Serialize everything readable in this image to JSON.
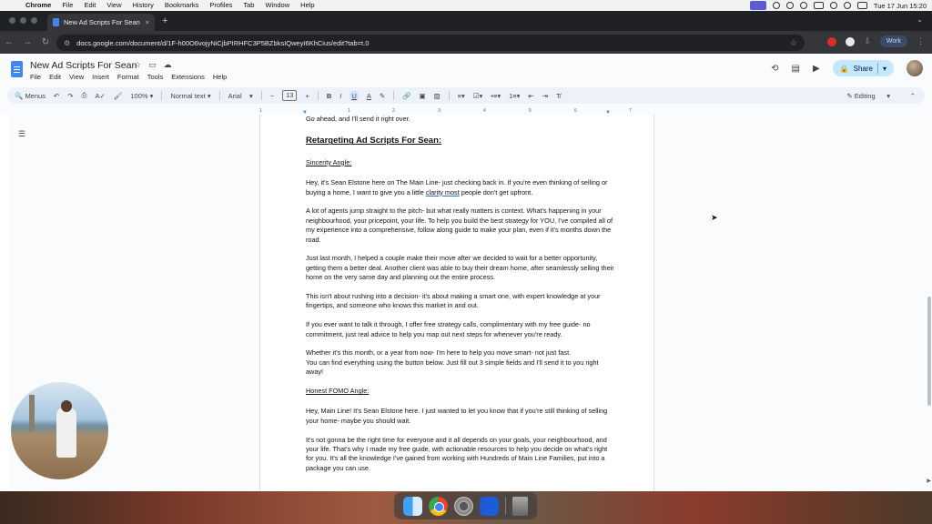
{
  "mac_menu": {
    "app": "Chrome",
    "items": [
      "File",
      "Edit",
      "View",
      "History",
      "Bookmarks",
      "Profiles",
      "Tab",
      "Window",
      "Help"
    ],
    "clock": "Tue 17 Jun  15:20"
  },
  "browser": {
    "tab_title": "New Ad Scripts For Sean - G",
    "url": "docs.google.com/document/d/1F-h00O6vojyNiCjbPIRHFC3P5BZbksIQweyI6KhCius/edit?tab=t.0",
    "profile_label": "Work"
  },
  "docs": {
    "title": "New Ad Scripts For Sean",
    "menu": [
      "File",
      "Edit",
      "View",
      "Insert",
      "Format",
      "Tools",
      "Extensions",
      "Help"
    ],
    "share_label": "Share",
    "toolbar": {
      "menus_label": "Menus",
      "zoom": "100%",
      "style": "Normal text",
      "font": "Arial",
      "font_size": "13",
      "mode": "Editing"
    },
    "ruler_numbers": [
      "1",
      "1",
      "2",
      "3",
      "4",
      "5",
      "6",
      "7"
    ]
  },
  "document": {
    "intro_tail": "Go ahead, and I'll send it right over.",
    "heading": "Retargeting Ad Scripts For Sean:",
    "sincerity_label": "Sincerity Angle:",
    "p1_a": "Hey, it's Sean Elstone here on The Main Line- just checking back in. If you're even thinking of selling or buying a home, I want to give you a little ",
    "p1_link": "clarity most",
    "p1_b": " people don't get upfront.",
    "p2": "A lot of agents jump straight to the pitch- but what really matters is context. What's happening in your neighbourhood, your pricepoint, your life. To help you build the best strategy for YOU, I've compiled all of my experience into a comprehensive, follow along guide to make your plan, even if it's months down the road.",
    "p3": "Just last month, I helped a couple make their move after we decided to wait for a better opportunity, getting them a better deal. Another client was able to buy their dream home, after seamlessly selling their home on the very same day and planning out the entire process.",
    "p4": "This isn't about rushing into a decision- it's about making a smart one, with expert knowledge at your fingertips, and someone who knows this market in and out.",
    "p5": "If you ever want to talk it through, I offer free strategy calls, complimentary with my free guide- no commitment, just real advice to help you map out next steps for whenever you're ready.",
    "p6_line1": "Whether it's this month, or a year from now- I'm here to help you move smart- not just fast.",
    "p6_line2": "You can find everything using the button below. Just fill out 3 simple fields and I'll send it to you right away!",
    "fomo_label": "Honest FOMO Angle:",
    "p7": "Hey, Main Line! It's Sean Elstone here. I just wanted to let you know that if you're still thinking of selling your home- maybe you should wait.",
    "p8": "It's not gonna be the right time for everyone and it all depends on your goals, your neighbourhood, and your life. That's why I made my free guide, with actionable resources to help you decide on what's right for you. It's all the knowledge I've gained from working with Hundreds of Main Line Families, put into a package you can use."
  },
  "dock": {
    "apps": [
      "finder-icon",
      "chrome-icon",
      "settings-icon",
      "xcode-icon",
      "trash-icon"
    ]
  },
  "colors": {
    "accent": "#1a73e8",
    "share_bg": "#c2e7ff",
    "format_bar_bg": "#edf2fa"
  }
}
